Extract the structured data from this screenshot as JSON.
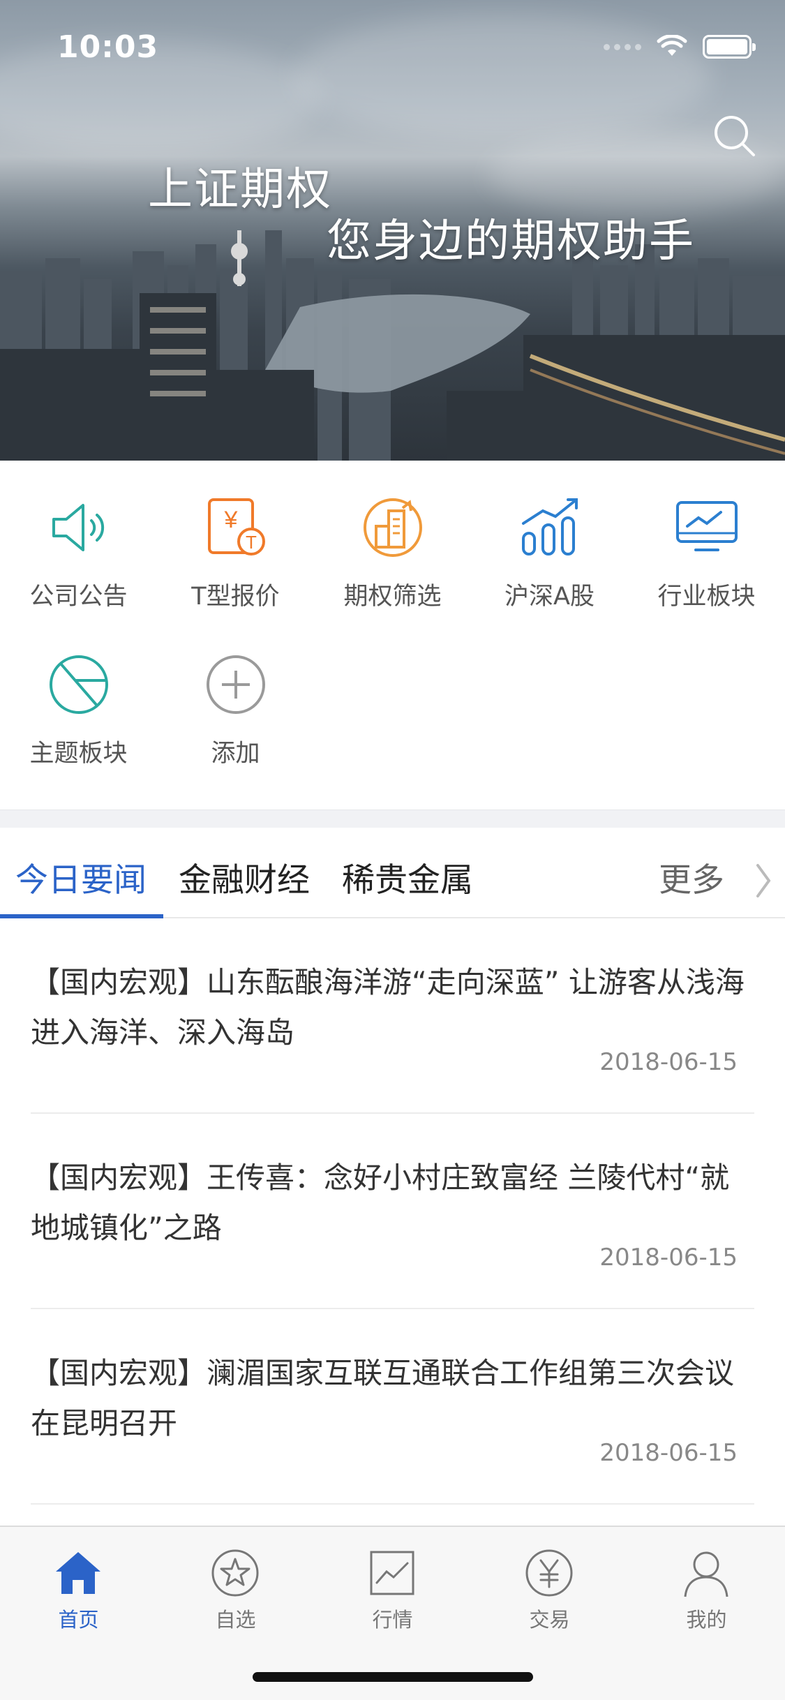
{
  "status_bar": {
    "time": "10:03"
  },
  "banner": {
    "title": "上证期权",
    "subtitle": "您身边的期权助手",
    "search_icon": "search-icon"
  },
  "quick_actions": [
    {
      "label": "公司公告",
      "icon": "speaker-icon",
      "color": "#2aa9a0"
    },
    {
      "label": "T型报价",
      "icon": "yen-t-document-icon",
      "color": "#f07a2a"
    },
    {
      "label": "期权筛选",
      "icon": "building-chart-icon",
      "color": "#f09a3a"
    },
    {
      "label": "沪深A股",
      "icon": "bar-trend-icon",
      "color": "#2b7fd0"
    },
    {
      "label": "行业板块",
      "icon": "monitor-chart-icon",
      "color": "#2b7fd0"
    },
    {
      "label": "主题板块",
      "icon": "pie-chart-icon",
      "color": "#2aa9a0"
    },
    {
      "label": "添加",
      "icon": "add-circle-icon",
      "color": "#9a9a9a"
    }
  ],
  "news_tabs": {
    "items": [
      "今日要闻",
      "金融财经",
      "稀贵金属"
    ],
    "active_index": 0,
    "more": "更多"
  },
  "news": [
    {
      "title": "【国内宏观】山东酝酿海洋游“走向深蓝” 让游客从浅海进入海洋、深入海岛",
      "date": "2018-06-15"
    },
    {
      "title": "【国内宏观】王传喜：念好小村庄致富经 兰陵代村“就地城镇化”之路",
      "date": "2018-06-15"
    },
    {
      "title": "【国内宏观】澜湄国家互联互通联合工作组第三次会议在昆明召开",
      "date": "2018-06-15"
    }
  ],
  "tab_bar": [
    {
      "label": "首页",
      "icon": "home-icon",
      "active": true
    },
    {
      "label": "自选",
      "icon": "star-icon",
      "active": false
    },
    {
      "label": "行情",
      "icon": "line-chart-icon",
      "active": false
    },
    {
      "label": "交易",
      "icon": "yen-coin-icon",
      "active": false
    },
    {
      "label": "我的",
      "icon": "user-icon",
      "active": false
    }
  ],
  "colors": {
    "accent": "#2b63c8",
    "text": "#333333",
    "muted": "#888888"
  }
}
